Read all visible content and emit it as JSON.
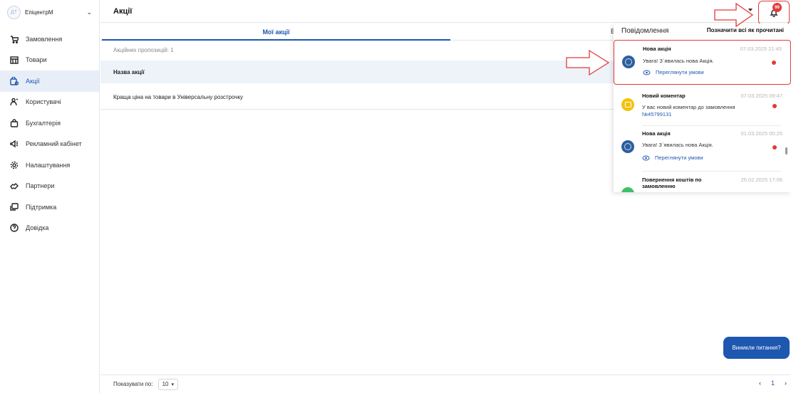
{
  "account": {
    "initials": "ДТ",
    "name": "ЕпіцентрМ"
  },
  "sidebar": {
    "items": [
      {
        "label": "Замовлення",
        "icon": "cart-icon"
      },
      {
        "label": "Товари",
        "icon": "store-icon"
      },
      {
        "label": "Акції",
        "icon": "promo-bag-icon",
        "active": true
      },
      {
        "label": "Користувачі",
        "icon": "users-icon"
      },
      {
        "label": "Бухгалтерія",
        "icon": "bag-icon"
      },
      {
        "label": "Рекламний кабінет",
        "icon": "megaphone-icon"
      },
      {
        "label": "Налаштування",
        "icon": "gear-icon"
      },
      {
        "label": "Партнери",
        "icon": "handshake-icon"
      },
      {
        "label": "Підтримка",
        "icon": "support-icon"
      },
      {
        "label": "Довідка",
        "icon": "help-icon"
      }
    ]
  },
  "header": {
    "title": "Акції",
    "badge_count": "99"
  },
  "tabs": {
    "my": "Мої акції",
    "other_partial": "В"
  },
  "list": {
    "count_label": "Акційних пропозицій: 1",
    "column_header": "Назва акції",
    "rows": [
      "Краща ціна на товари в Універсальну розстрочку"
    ]
  },
  "pagination": {
    "per_page_label": "Показувати по:",
    "per_page_value": "10",
    "page": "1"
  },
  "help_button": "Виникли питання?",
  "notifications": {
    "title": "Повідомлення",
    "mark_all": "Позначити всі як прочитані",
    "items": [
      {
        "title": "Нова акція",
        "date": "07.03.2025 21:45",
        "text": "Увага! З`явилась нова Акція.",
        "link": "Переглянути умови",
        "type": "promo"
      },
      {
        "title": "Новий коментар",
        "date": "07.03.2025 09:47",
        "text": "У вас новий коментар до замовлення",
        "order": "№45799131",
        "type": "comment"
      },
      {
        "title": "Нова акція",
        "date": "01.03.2025 00:25",
        "text": "Увага! З`явилась нова Акція.",
        "link": "Переглянути умови",
        "type": "promo"
      },
      {
        "title": "Повернення коштів по замовленню",
        "date": "25.02.2025 17:06",
        "type": "refund"
      }
    ]
  },
  "colors": {
    "primary": "#1d57b0",
    "alert": "#e23a3a",
    "active_bg": "#e8eef8"
  }
}
